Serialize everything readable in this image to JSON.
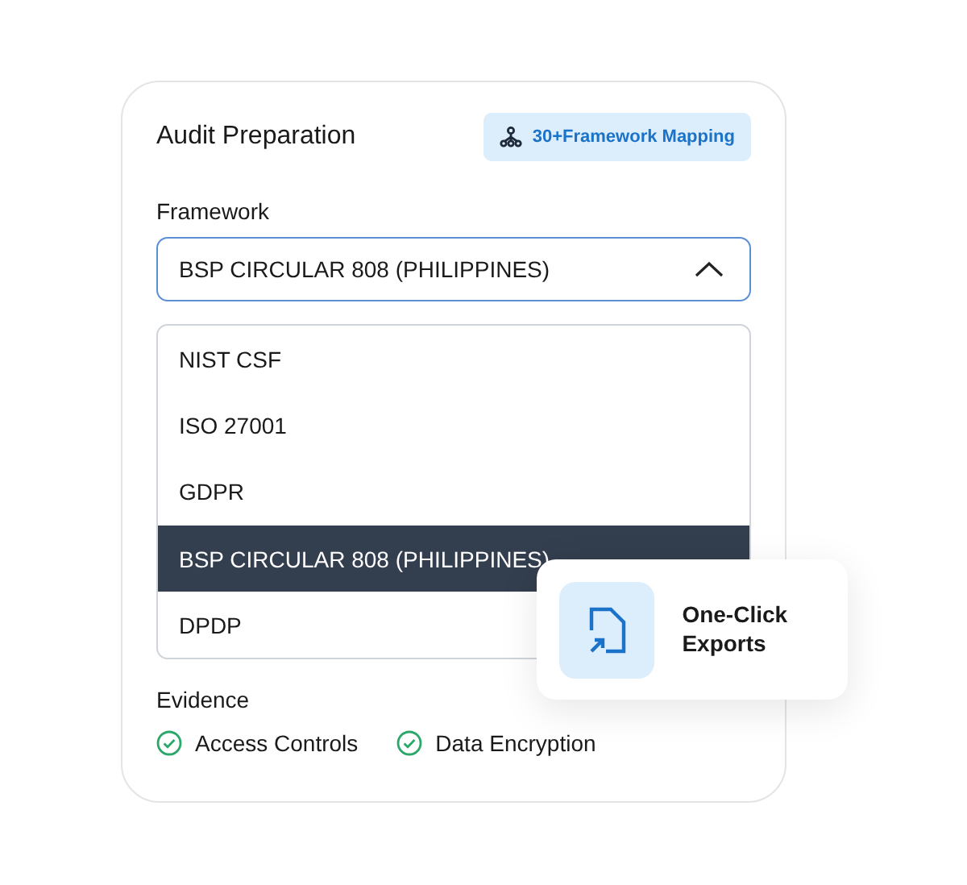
{
  "card": {
    "title": "Audit Preparation",
    "badge": "30+Framework Mapping"
  },
  "framework": {
    "label": "Framework",
    "value": "BSP CIRCULAR 808 (PHILIPPINES)",
    "expanded": true,
    "options": [
      {
        "label": "NIST CSF",
        "selected": false
      },
      {
        "label": "ISO 27001",
        "selected": false
      },
      {
        "label": "GDPR",
        "selected": false
      },
      {
        "label": "BSP CIRCULAR 808 (PHILIPPINES)",
        "selected": true
      },
      {
        "label": "DPDP",
        "selected": false
      }
    ]
  },
  "evidence": {
    "label": "Evidence",
    "items": [
      {
        "label": "Access Controls",
        "checked": true
      },
      {
        "label": "Data Encryption",
        "checked": true
      }
    ]
  },
  "export_card": {
    "label": "One-Click Exports"
  }
}
